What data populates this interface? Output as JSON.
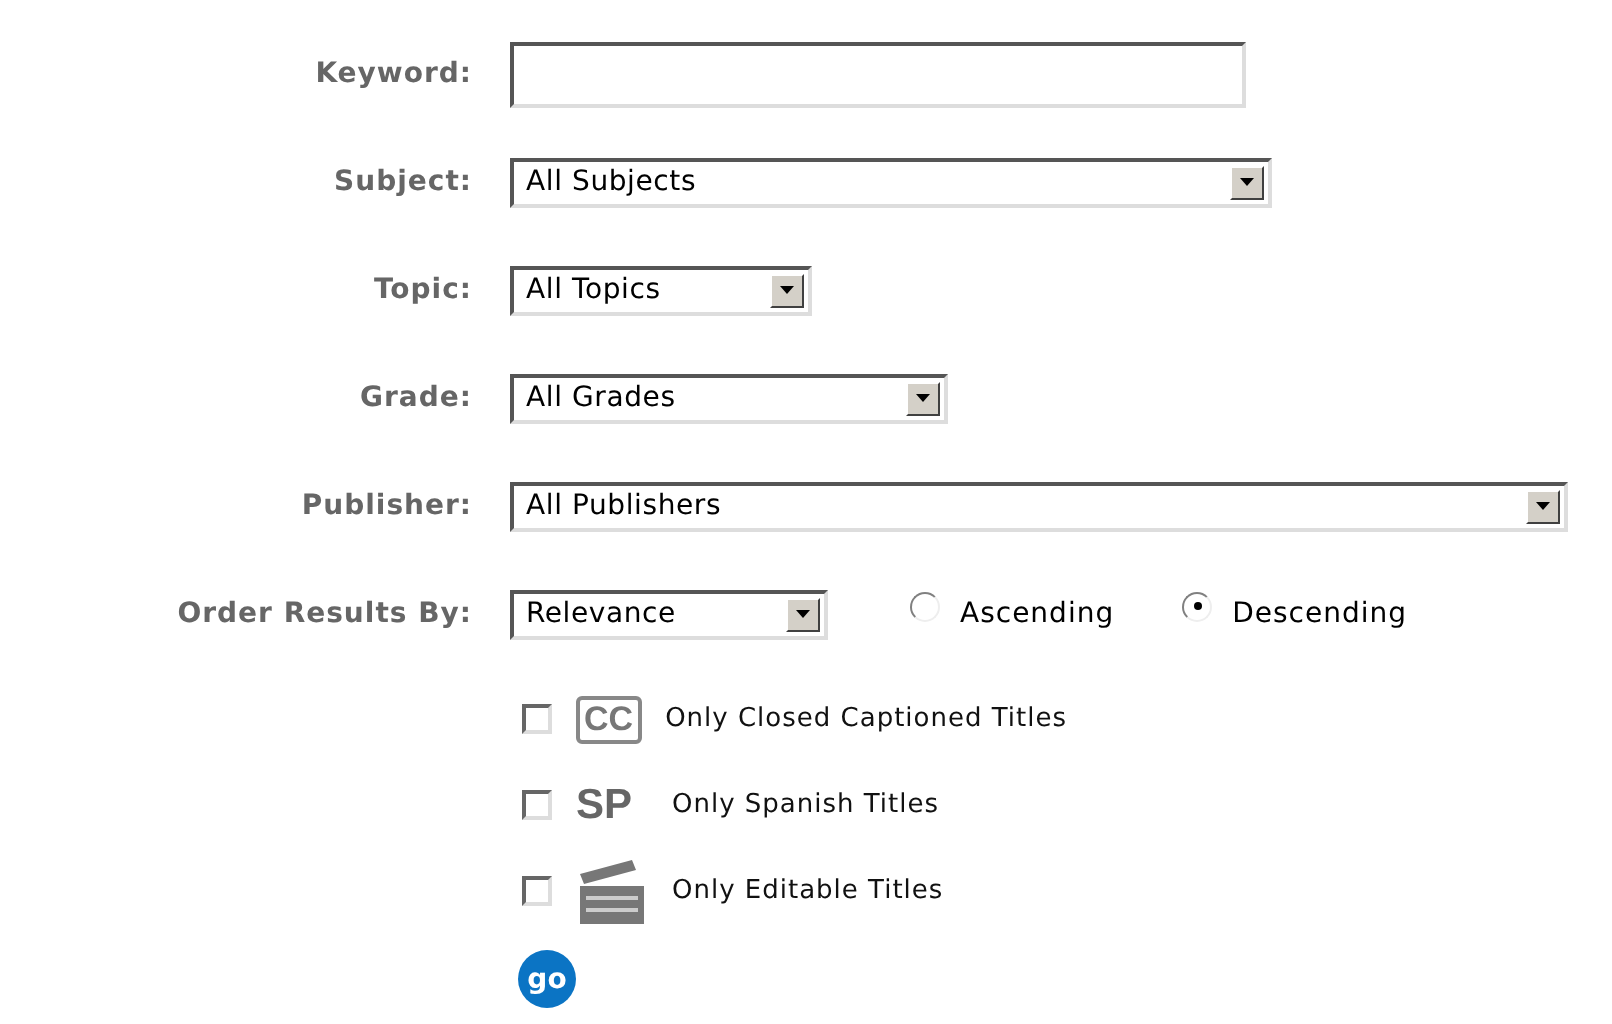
{
  "fields": [
    {
      "kind": "text",
      "label": "Keyword:"
    },
    {
      "kind": "select",
      "label": "Subject:",
      "value": "All Subjects"
    },
    {
      "kind": "select",
      "label": "Topic:",
      "value": "All Topics"
    },
    {
      "kind": "select",
      "label": "Grade:",
      "value": "All Grades"
    },
    {
      "kind": "select",
      "label": "Publisher:",
      "value": "All Publishers"
    }
  ],
  "order": {
    "label": "Order Results By:",
    "value": "Relevance",
    "directions": [
      {
        "label": "Ascending",
        "selected": false
      },
      {
        "label": "Descending",
        "selected": true
      }
    ]
  },
  "filters": [
    {
      "kind": "boxed",
      "badge": "CC",
      "label": "Only Closed Captioned Titles",
      "checked": false
    },
    {
      "kind": "plain",
      "badge": "SP",
      "label": "Only Spanish Titles",
      "checked": false
    },
    {
      "kind": "clapper",
      "label": "Only Editable Titles",
      "checked": false
    }
  ],
  "submit": {
    "label": "go"
  }
}
